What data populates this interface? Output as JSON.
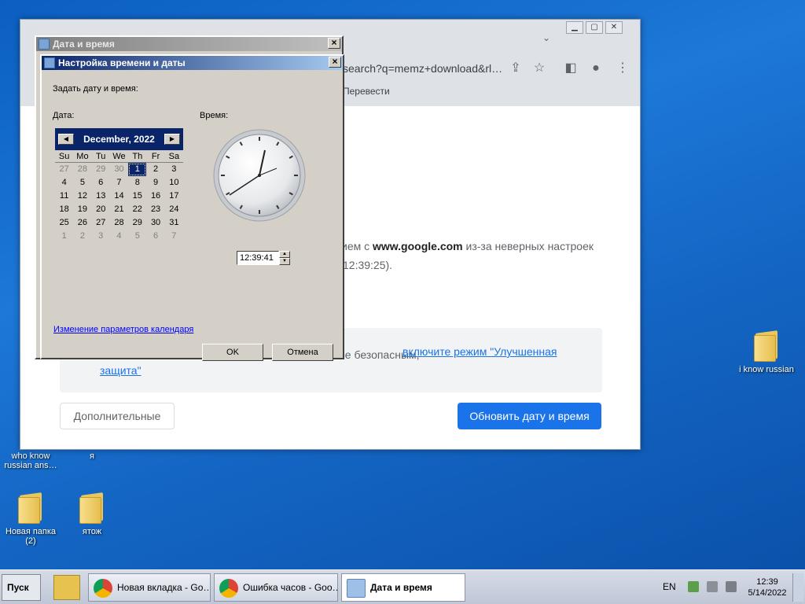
{
  "desktop": {
    "icons": [
      {
        "label": "i know russian"
      },
      {
        "label": "who know russian ans…"
      },
      {
        "label": "я"
      },
      {
        "label": "Новая папка (2)"
      },
      {
        "label": "ятож"
      }
    ]
  },
  "chrome": {
    "url_fragment": "search?q=memz+download&rl…",
    "bookmark_translate": "Перевести",
    "body_line1_pre": "ием с",
    "body_line1_domain": "www.google.com",
    "body_line1_post": "из-за неверных настроек",
    "body_line2": "12:39:25).",
    "info_pre": "ее безопасным,",
    "info_link": "включите режим \"Улучшенная защита\".",
    "btn_advanced": "Дополнительные",
    "btn_update": "Обновить дату и время"
  },
  "outer_window": {
    "title": "Дата и время"
  },
  "dialog": {
    "title": "Настройка времени и даты",
    "set_label": "Задать дату и время:",
    "date_label": "Дата:",
    "time_label": "Время:",
    "calendar": {
      "month_title": "December, 2022",
      "weekdays": [
        "Su",
        "Mo",
        "Tu",
        "We",
        "Th",
        "Fr",
        "Sa"
      ],
      "weeks": [
        [
          "27",
          "28",
          "29",
          "30",
          "1",
          "2",
          "3"
        ],
        [
          "4",
          "5",
          "6",
          "7",
          "8",
          "9",
          "10"
        ],
        [
          "11",
          "12",
          "13",
          "14",
          "15",
          "16",
          "17"
        ],
        [
          "18",
          "19",
          "20",
          "21",
          "22",
          "23",
          "24"
        ],
        [
          "25",
          "26",
          "27",
          "28",
          "29",
          "30",
          "31"
        ],
        [
          "1",
          "2",
          "3",
          "4",
          "5",
          "6",
          "7"
        ]
      ],
      "selected_day": "1"
    },
    "time_value": "12:39:41",
    "calendar_settings_link": "Изменение параметров календаря",
    "ok_label": "OK",
    "cancel_label": "Отмена"
  },
  "taskbar": {
    "start_label": "Пуск",
    "tasks": [
      "Новая вкладка - Go…",
      "Ошибка часов - Goo…",
      "Дата и время"
    ],
    "language": "EN",
    "clock_time": "12:39",
    "clock_date": "5/14/2022"
  },
  "colors": {
    "accent": "#1a73e8",
    "classic_title": "#0a246a"
  }
}
